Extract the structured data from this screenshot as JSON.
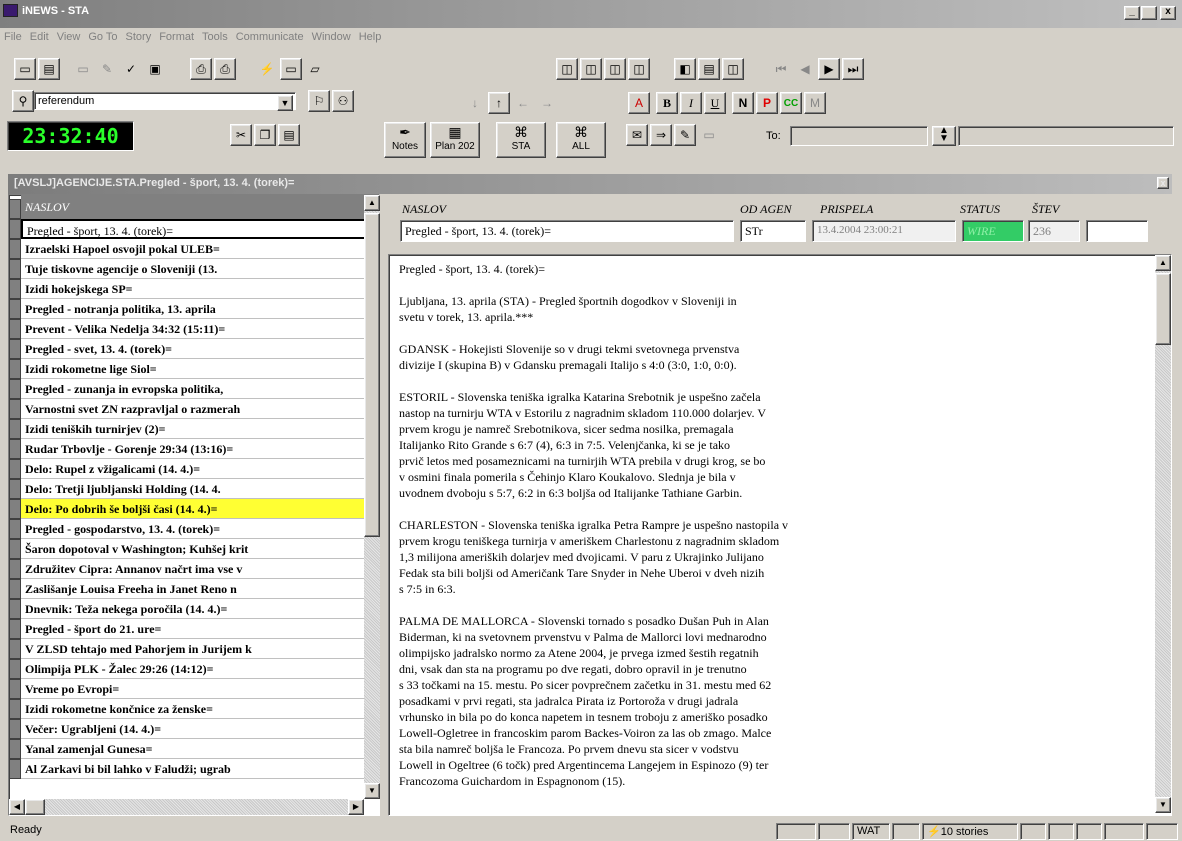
{
  "window": {
    "title": "iNEWS - STA",
    "min": "_",
    "max": " ",
    "close": "x"
  },
  "menu": [
    "File",
    "Edit",
    "View",
    "Go To",
    "Story",
    "Format",
    "Tools",
    "Communicate",
    "Window",
    "Help"
  ],
  "search": {
    "value": "referendum"
  },
  "clock": "23:32:40",
  "big_buttons": [
    {
      "label": "Notes",
      "icon": "quill-icon"
    },
    {
      "label": "Plan 202",
      "icon": "plan-icon"
    },
    {
      "label": "STA",
      "icon": "satellite-icon"
    },
    {
      "label": "ALL",
      "icon": "satellite-all-icon"
    }
  ],
  "format_buttons": {
    "bold": "B",
    "italic": "I",
    "underline": "U",
    "n": "N",
    "p": "P",
    "cc": "CC",
    "m": "M"
  },
  "to_label": "To:",
  "panel_title": "[AVSLJ]AGENCIJE.STA.Pregled - šport, 13. 4. (torek)=",
  "queue": {
    "header": "NASLOV",
    "rows": [
      "Pregled - šport, 13. 4. (torek)=",
      "Izraelski Hapoel osvojil pokal ULEB=",
      "Tuje tiskovne agencije o Sloveniji (13.",
      "Izidi hokejskega SP=",
      "Pregled - notranja politika, 13. aprila",
      "Prevent - Velika Nedelja 34:32 (15:11)=",
      "Pregled - svet, 13. 4. (torek)=",
      "Izidi rokometne lige Siol=",
      "Pregled - zunanja in evropska politika,",
      "Varnostni svet ZN razpravljal o razmerah",
      "Izidi teniških turnirjev (2)=",
      "Rudar Trbovlje - Gorenje 29:34 (13:16)=",
      "Delo: Rupel z vžigalicami (14. 4.)=",
      "Delo: Tretji ljubljanski Holding (14. 4.",
      "Delo: Po dobrih še boljši časi (14. 4.)=",
      "Pregled - gospodarstvo, 13. 4. (torek)=",
      "Šaron dopotoval v Washington; Kuhšej krit",
      "Združitev Cipra: Annanov načrt ima vse v",
      "Zaslišanje Louisa Freeha in Janet Reno n",
      "Dnevnik: Teža nekega poročila (14. 4.)=",
      "Pregled - šport do 21. ure=",
      "V ZLSD tehtajo med Pahorjem in Jurijem k",
      "Olimpija PLK - Žalec 29:26 (14:12)=",
      "Vreme po Evropi=",
      "Izidi rokometne končnice za ženske=",
      "Večer: Ugrabljeni (14. 4.)=",
      "Yanal zamenjal Gunesa=",
      "Al Zarkavi bi bil lahko v Faludži; ugrab"
    ]
  },
  "detail": {
    "labels": {
      "naslov": "NASLOV",
      "od_agen": "OD AGEN",
      "prispela": "PRISPELA",
      "status": "STATUS",
      "stev": "ŠTEV"
    },
    "naslov": "Pregled - šport, 13. 4. (torek)=",
    "od_agen": "STr",
    "prispela": "13.4.2004 23:00:21",
    "status": "WIRE",
    "stev": "236"
  },
  "story": {
    "paragraphs": [
      "Pregled - šport, 13. 4. (torek)=",
      "Ljubljana, 13. aprila (STA) - Pregled športnih dogodkov v Sloveniji in\nsvetu v torek, 13. aprila.***",
      "GDANSK - Hokejisti Slovenije so v drugi tekmi svetovnega prvenstva\ndivizije I (skupina B) v Gdansku premagali Italijo s 4:0 (3:0, 1:0, 0:0).",
      "ESTORIL - Slovenska teniška igralka Katarina Srebotnik je uspešno začela\nnastop na turnirju WTA v Estorilu z nagradnim skladom 110.000 dolarjev. V\nprvem krogu je namreč Srebotnikova, sicer sedma nosilka, premagala\nItalijanko Rito Grande s 6:7 (4), 6:3 in 7:5. Velenjčanka, ki se je tako\nprvič letos med posameznicami na turnirjih WTA prebila v drugi krog, se bo\nv osmini finala pomerila s Čehinjo Klaro Koukalovo. Slednja je bila v\nuvodnem dvoboju s 5:7, 6:2 in 6:3 boljša od Italijanke Tathiane Garbin.",
      "CHARLESTON - Slovenska teniška igralka Petra Rampre je uspešno nastopila v\nprvem krogu teniškega turnirja v ameriškem Charlestonu z nagradnim skladom\n1,3 milijona ameriških dolarjev med dvojicami. V paru z Ukrajinko Julijano\nFedak sta bili boljši od Američank Tare Snyder in Nehe Uberoi v dveh nizih\ns 7:5 in 6:3.",
      "PALMA DE MALLORCA - Slovenski tornado s posadko Dušan Puh in Alan\nBiderman, ki na svetovnem prvenstvu v Palma de Mallorci lovi mednarodno\nolimpijsko jadralsko normo za Atene 2004, je prvega izmed šestih regatnih\ndni, vsak dan sta na programu po dve regati, dobro opravil in je trenutno\ns 33 točkami na 15. mestu. Po sicer povprečnem začetku in 31. mestu med 62\nposadkami v prvi regati, sta jadralca Pirata iz Portoroža v drugi jadrala\nvrhunsko in bila po do konca napetem in tesnem troboju z ameriško posadko\nLowell-Ogletree in francoskim parom Backes-Voiron za las ob zmago. Malce\nsta bila namreč boljša le Francoza. Po prvem dnevu sta sicer v vodstvu\nLowell in Ogeltree (6 točk) pred Argentincema Langejem in Espinozo (9) ter\nFrancozoma Guichardom in Espagnonom (15)."
    ]
  },
  "statusbar": {
    "ready": "Ready",
    "wat": "WAT",
    "stories": "10 stories"
  },
  "colors": {
    "highlight": "#ffff33",
    "status_wire": "#33cc66",
    "clock": "#2aff2a"
  }
}
